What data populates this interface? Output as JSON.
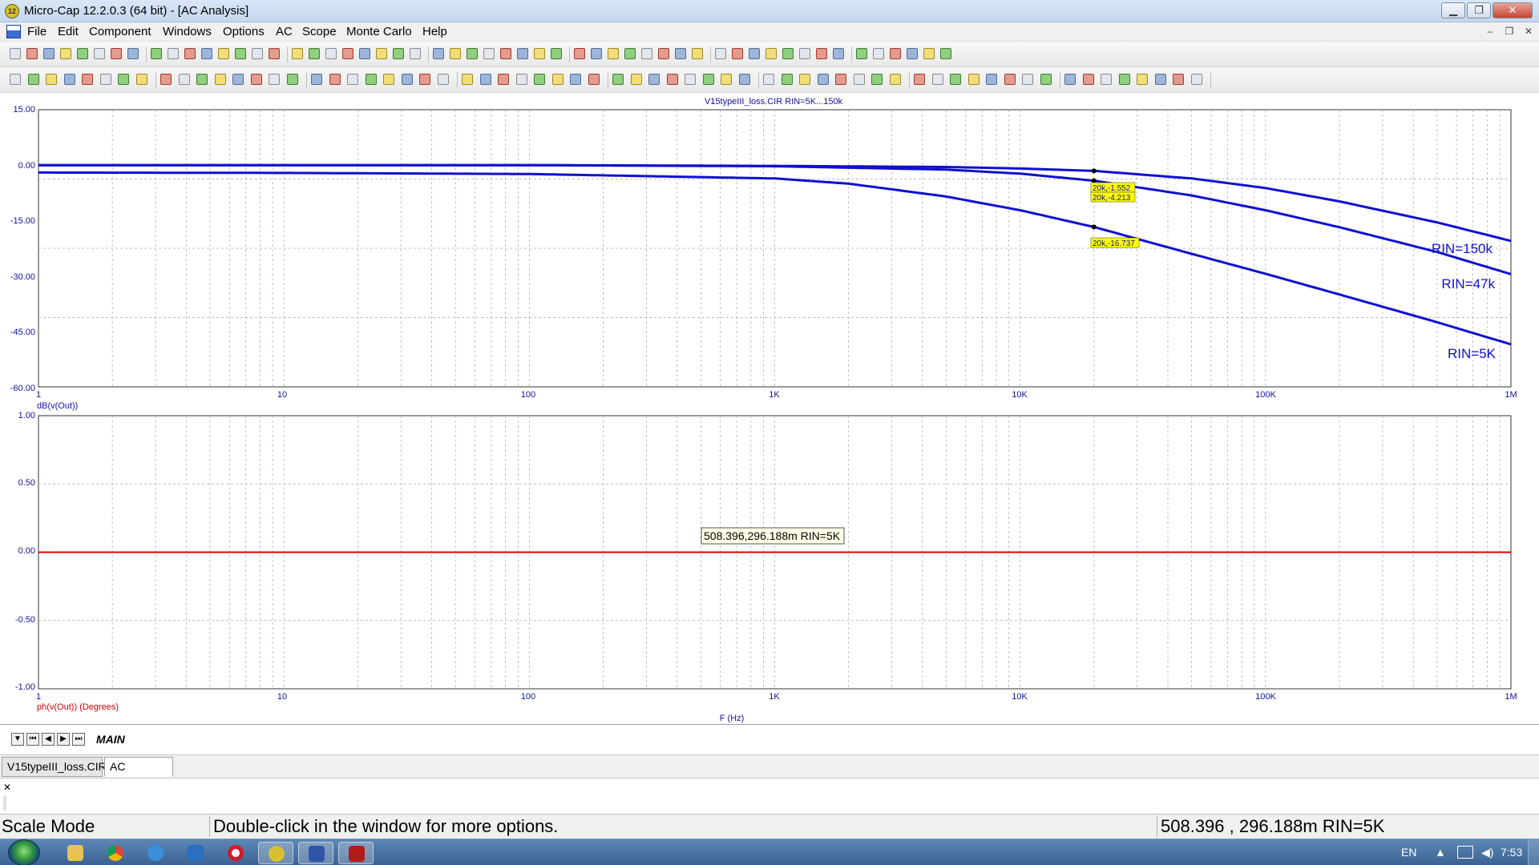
{
  "window": {
    "title": "Micro-Cap 12.2.0.3 (64 bit) - [AC Analysis]",
    "app_icon_text": "12",
    "controls": [
      "minimize",
      "restore",
      "close"
    ]
  },
  "menubar": {
    "items": [
      "File",
      "Edit",
      "Component",
      "Windows",
      "Options",
      "AC",
      "Scope",
      "Monte Carlo",
      "Help"
    ]
  },
  "plot": {
    "title": "V15typeIII_loss.CIR RIN=5K...150k",
    "x_label": "F (Hz)",
    "top": {
      "y_label": "dB(v(Out))",
      "y_ticks": [
        "15.00",
        "0.00",
        "-15.00",
        "-30.00",
        "-45.00",
        "-60.00"
      ],
      "x_ticks": [
        "1",
        "10",
        "100",
        "1K",
        "10K",
        "100K",
        "1M"
      ]
    },
    "bottom": {
      "y_label": "ph(v(Out)) (Degrees)",
      "y_ticks": [
        "1.00",
        "0.50",
        "0.00",
        "-0.50",
        "-1.00"
      ],
      "x_ticks": [
        "1",
        "10",
        "100",
        "1K",
        "10K",
        "100K",
        "1M"
      ]
    },
    "curve_labels": [
      "RIN=150k",
      "RIN=47k",
      "RIN=5K"
    ],
    "cursor_labels": [
      "20k,-1.552",
      "20k,-4.213",
      "20k,-16.737"
    ],
    "cursor_tooltip": "508.396,296.188m RIN=5K",
    "colors": {
      "curve": "#1010d0",
      "phase": "#e00000",
      "grid": "#a8a8a8",
      "axis": "#000000",
      "label_bg": "#ffff00"
    }
  },
  "chart_data": [
    {
      "type": "line",
      "title": "V15typeIII_loss.CIR RIN=5K...150k",
      "xlabel": "F (Hz)",
      "ylabel": "dB(v(Out))",
      "xscale": "log",
      "xlim": [
        1,
        1000000
      ],
      "ylim": [
        -60,
        15
      ],
      "series": [
        {
          "name": "RIN=150k",
          "x": [
            1,
            10,
            100,
            1000,
            5000,
            10000,
            20000,
            50000,
            100000,
            200000,
            500000,
            1000000
          ],
          "y": [
            0,
            0,
            0,
            -0.2,
            -0.5,
            -0.9,
            -1.552,
            -3.6,
            -6.2,
            -9.8,
            -15.5,
            -20.5
          ]
        },
        {
          "name": "RIN=47k",
          "x": [
            1,
            10,
            100,
            1000,
            5000,
            10000,
            20000,
            50000,
            100000,
            200000,
            500000,
            1000000
          ],
          "y": [
            0,
            0,
            0,
            -0.3,
            -1.2,
            -2.3,
            -4.213,
            -8.2,
            -12.2,
            -16.8,
            -23.5,
            -29.5
          ]
        },
        {
          "name": "RIN=5K",
          "x": [
            1,
            10,
            100,
            1000,
            2000,
            5000,
            10000,
            20000,
            50000,
            100000,
            200000,
            500000,
            1000000
          ],
          "y": [
            -2.0,
            -2.1,
            -2.4,
            -3.6,
            -5.0,
            -8.5,
            -12.2,
            -16.737,
            -24.0,
            -29.4,
            -35.0,
            -42.5,
            -48.5
          ]
        }
      ]
    },
    {
      "type": "line",
      "xlabel": "F (Hz)",
      "ylabel": "ph(v(Out)) (Degrees)",
      "xscale": "log",
      "xlim": [
        1,
        1000000
      ],
      "ylim": [
        -1,
        1
      ],
      "series": [
        {
          "x": [
            1,
            1000000
          ],
          "y": [
            0,
            0
          ]
        }
      ]
    }
  ],
  "tabs": {
    "sheet": "MAIN"
  },
  "doc_tabs": [
    "V15typeIII_loss.CIR",
    "AC Analysis"
  ],
  "status": {
    "mode": "Scale Mode",
    "hint": "Double-click in the window for more options.",
    "readout": "508.396 , 296.188m RIN=5K"
  },
  "taskbar": {
    "lang": "EN",
    "time": "7:53"
  }
}
